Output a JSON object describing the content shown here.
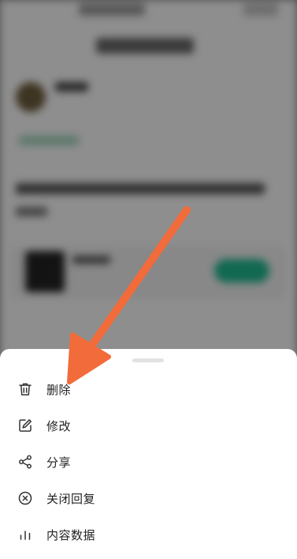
{
  "menu": {
    "items": [
      {
        "label": "删除",
        "icon": "trash-icon"
      },
      {
        "label": "修改",
        "icon": "edit-icon"
      },
      {
        "label": "分享",
        "icon": "share-icon"
      },
      {
        "label": "关闭回复",
        "icon": "close-circle-icon"
      },
      {
        "label": "内容数据",
        "icon": "bar-chart-icon"
      }
    ]
  },
  "colors": {
    "annotation_arrow": "#f26b3a",
    "icon": "#333333",
    "text": "#222222",
    "sheet_bg": "#ffffff",
    "overlay": "#000000"
  }
}
